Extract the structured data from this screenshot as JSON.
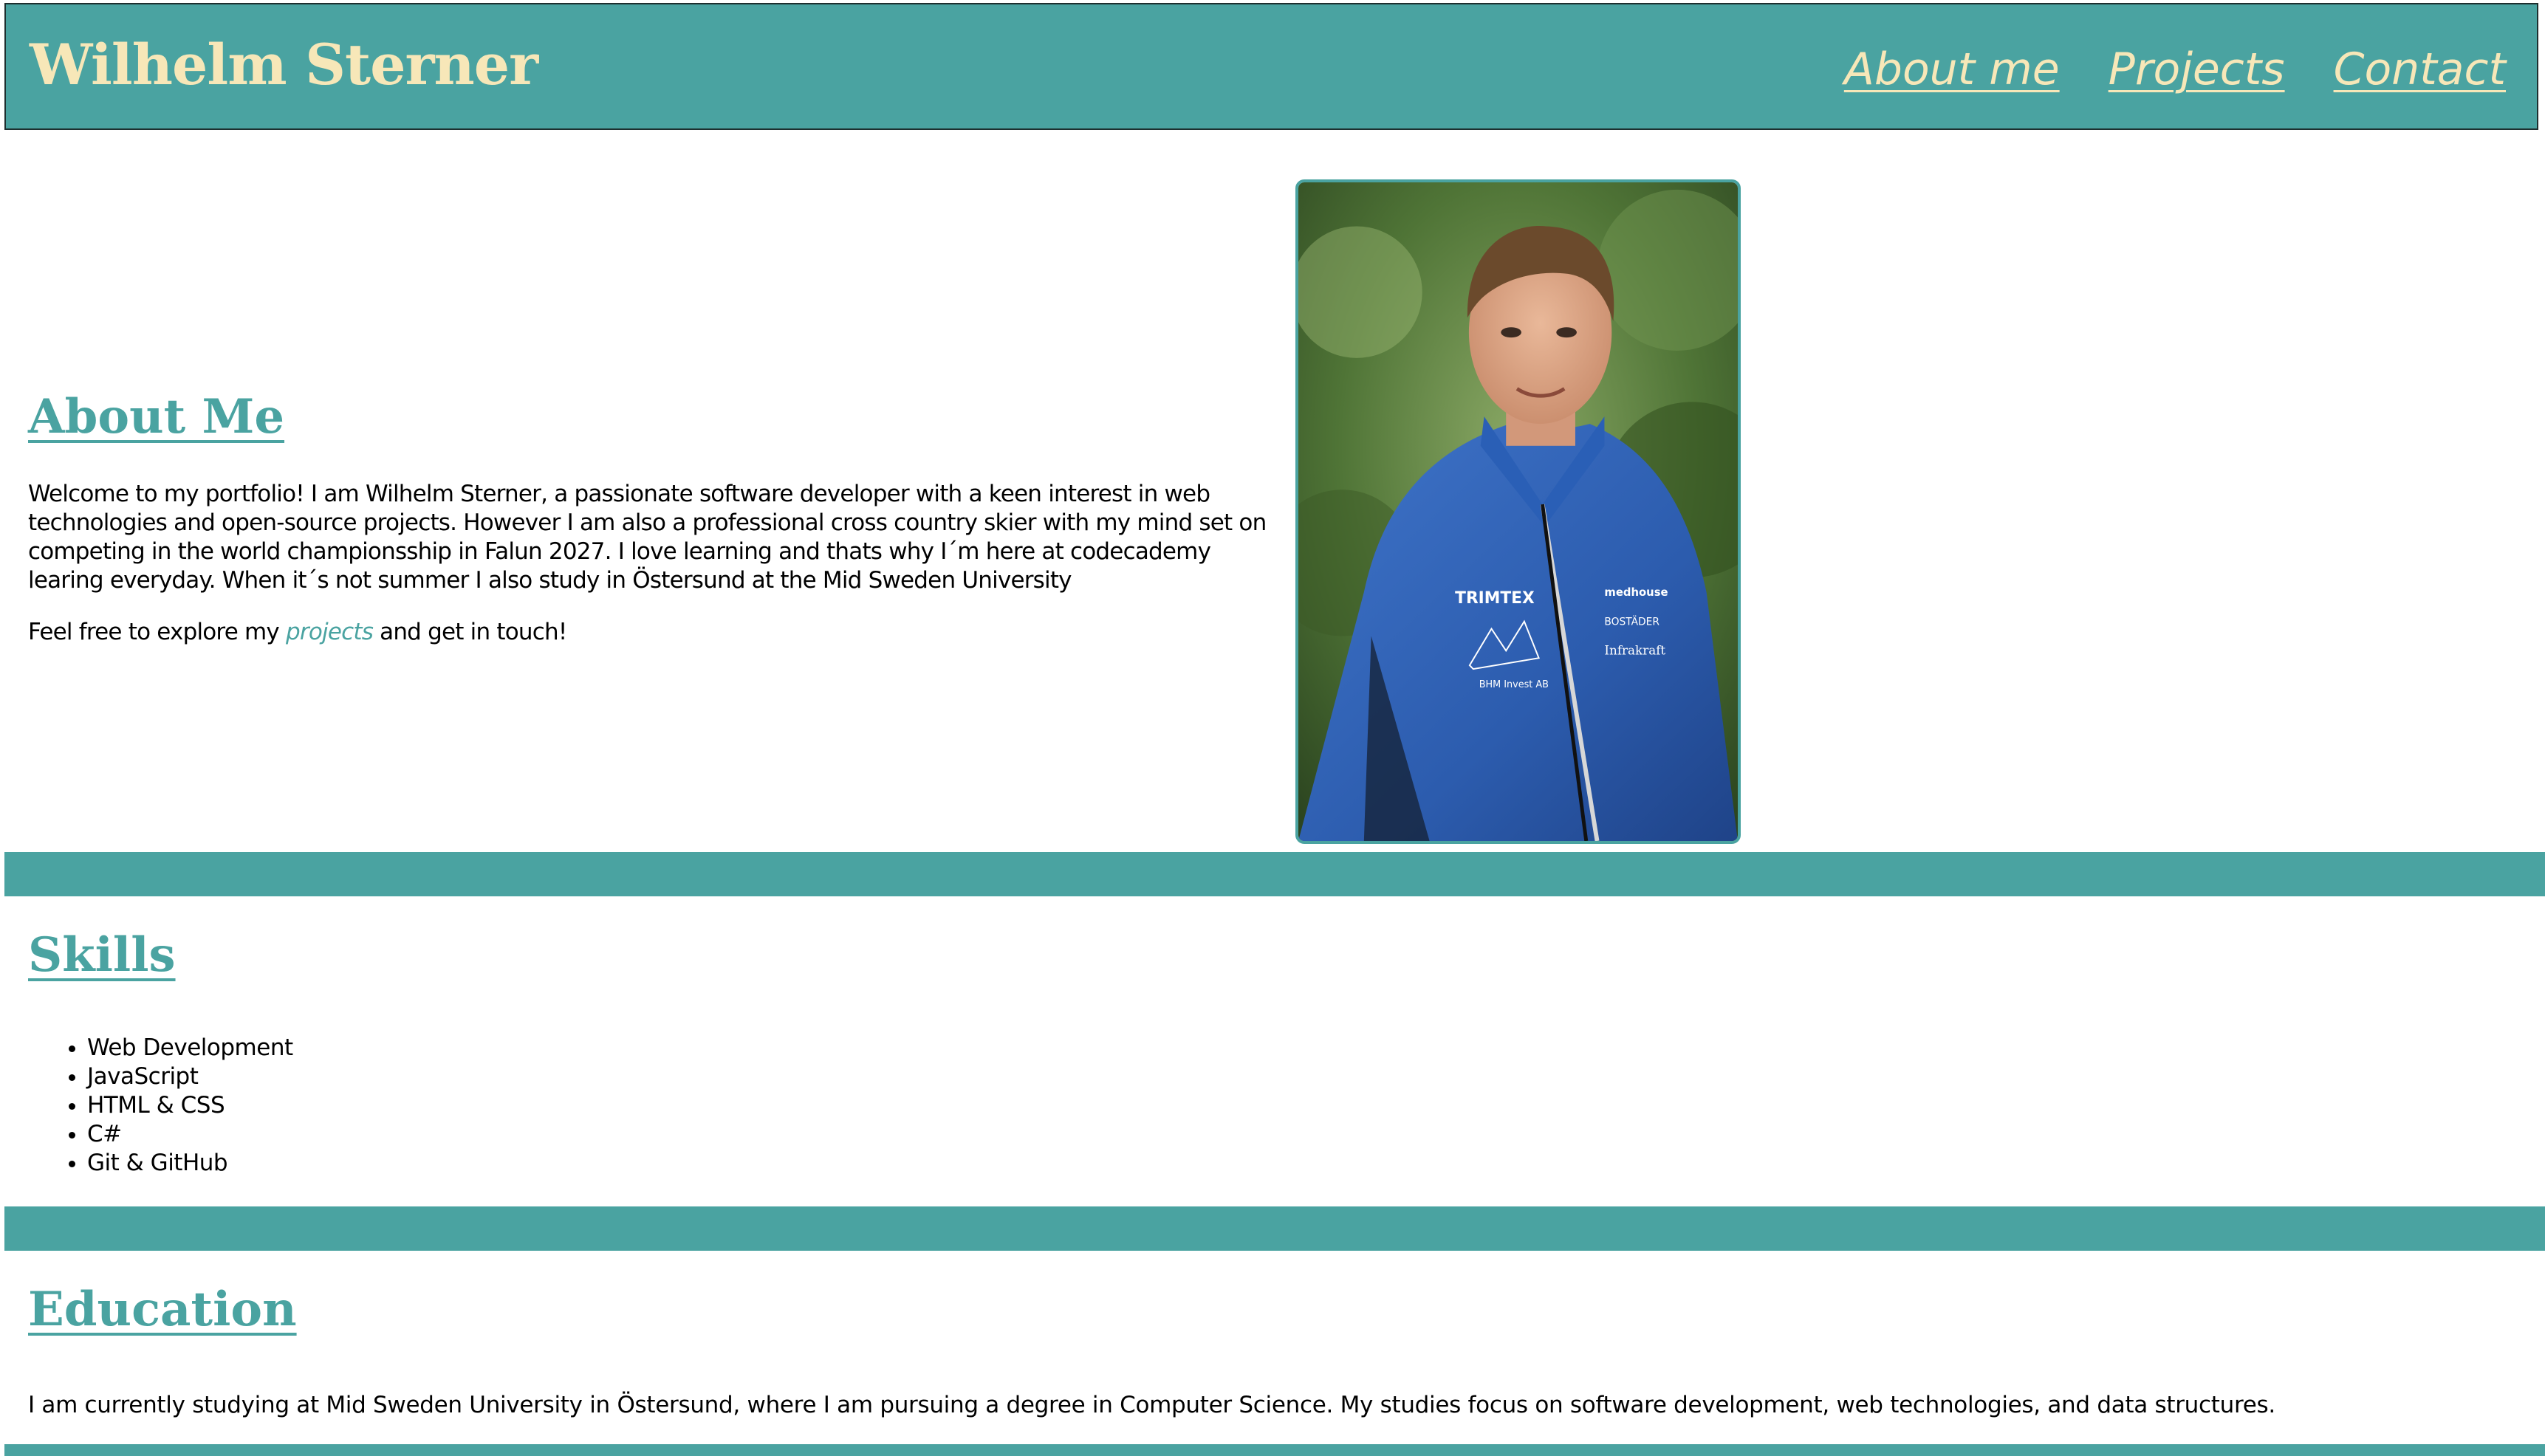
{
  "header": {
    "title": "Wilhelm Sterner",
    "nav": [
      {
        "label": "About me"
      },
      {
        "label": "Projects"
      },
      {
        "label": "Contact"
      }
    ]
  },
  "about": {
    "heading": "About Me",
    "paragraph": "Welcome to my portfolio! I am Wilhelm Sterner, a passionate software developer with a keen interest in web technologies and open-source projects. However I am also a professional cross country skier with my mind set on competing in the world championsship in Falun 2027. I love learning and thats why I´m here at codecademy learing everyday. When it´s not summer I also study in Östersund at the Mid Sweden University",
    "explore_prefix": "Feel free to explore my ",
    "explore_link": "projects",
    "explore_suffix": " and get in touch!",
    "photo_jacket_texts": [
      "TRIMTEX",
      "BHM Invest AB",
      "medhouse",
      "BOSTÄDER",
      "Infrakraft"
    ]
  },
  "skills": {
    "heading": "Skills",
    "items": [
      "Web Development",
      "JavaScript",
      "HTML & CSS",
      "C#",
      "Git & GitHub"
    ]
  },
  "education": {
    "heading": "Education",
    "paragraph": "I am currently studying at Mid Sweden University in Östersund, where I am pursuing a degree in Computer Science. My studies focus on software development, web technologies, and data structures."
  },
  "colors": {
    "accent": "#4aa3a1",
    "title_text": "#f7e7b8",
    "body_text": "#000000"
  }
}
